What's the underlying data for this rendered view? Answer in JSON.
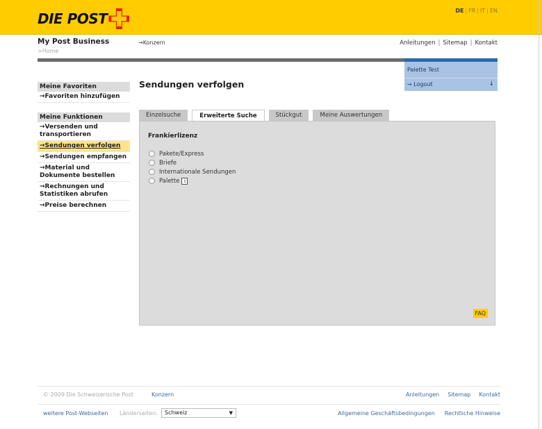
{
  "header": {
    "logo_text": "DIE POST",
    "languages": [
      {
        "code": "DE",
        "active": true
      },
      {
        "code": "FR",
        "active": false
      },
      {
        "code": "IT",
        "active": false
      },
      {
        "code": "EN",
        "active": false
      }
    ],
    "lang_separator": "|"
  },
  "topbar": {
    "brand": "My Post Business",
    "breadcrumb": ">Home",
    "konzern": "→Konzern",
    "links": [
      "Anleitungen",
      "Sitemap",
      "Kontakt"
    ],
    "link_separator": "|"
  },
  "userbox": {
    "user_name": "Palette Test",
    "logout": "→ Logout",
    "arrow": "↓"
  },
  "sidebar": {
    "favorites_title": "Meine Favoriten",
    "favorites_add": "→Favoriten hinzufügen",
    "functions_title": "Meine Funktionen",
    "items": [
      {
        "label": "→Versenden und transportieren",
        "active": false
      },
      {
        "label": "→Sendungen verfolgen",
        "active": true
      },
      {
        "label": "→Sendungen empfangen",
        "active": false
      },
      {
        "label": "→Material und Dokumente bestellen",
        "active": false
      },
      {
        "label": "→Rechnungen und Statistiken abrufen",
        "active": false
      },
      {
        "label": "→Preise berechnen",
        "active": false
      }
    ]
  },
  "main": {
    "title": "Sendungen verfolgen",
    "tabs": [
      {
        "label": "Einzelsuche",
        "active": false
      },
      {
        "label": "Erweiterte Suche",
        "active": true
      },
      {
        "label": "Stückgut",
        "active": false
      },
      {
        "label": "Meine Auswertungen",
        "active": false
      }
    ],
    "panel_heading": "Frankierlizenz",
    "options": [
      {
        "label": "Pakete/Express",
        "info": false
      },
      {
        "label": "Briefe",
        "info": false
      },
      {
        "label": "Internationale Sendungen",
        "info": false
      },
      {
        "label": "Palette",
        "info": true
      }
    ],
    "info_glyph": "i",
    "faq": "FAQ"
  },
  "footer": {
    "copyright": "© 2009 Die Schweizerische Post",
    "konzern": "Konzern",
    "links_right": [
      "Anleitungen",
      "Sitemap",
      "Kontakt"
    ],
    "more_sites": "weitere Post-Webseiten",
    "country_label": "Länderseiten:",
    "country_selected": "Schweiz",
    "caret": "▼",
    "legal_links": [
      "Allgemeine Geschäftsbedingungen",
      "Rechtliche Hinweise"
    ]
  },
  "colors": {
    "brand_yellow": "#ffcc00",
    "brand_red": "#e52213",
    "user_blue": "#a9c3e4",
    "link_blue": "#3f6a9a"
  }
}
